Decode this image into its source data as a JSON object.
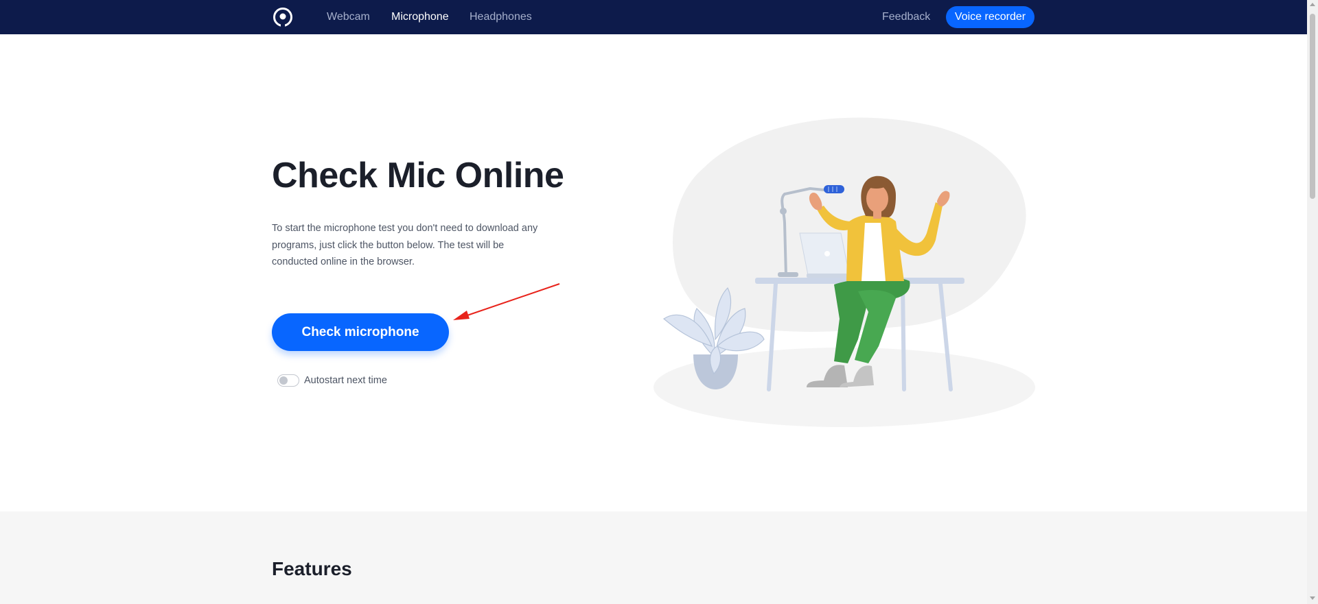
{
  "header": {
    "logo_icon": "mic-ring-logo-icon",
    "nav": [
      {
        "label": "Webcam",
        "active": false
      },
      {
        "label": "Microphone",
        "active": true
      },
      {
        "label": "Headphones",
        "active": false
      }
    ],
    "feedback_label": "Feedback",
    "voice_recorder_label": "Voice recorder"
  },
  "hero": {
    "title": "Check Mic Online",
    "description": "To start the microphone test you don't need to download any programs, just click the button below. The test will be conducted online in the browser.",
    "check_button_label": "Check microphone",
    "autostart_label": "Autostart next time",
    "autostart_enabled": false
  },
  "features": {
    "title": "Features"
  },
  "colors": {
    "header_bg": "#0d1b4b",
    "accent": "#0866ff",
    "annotation_arrow": "#e8231b"
  }
}
